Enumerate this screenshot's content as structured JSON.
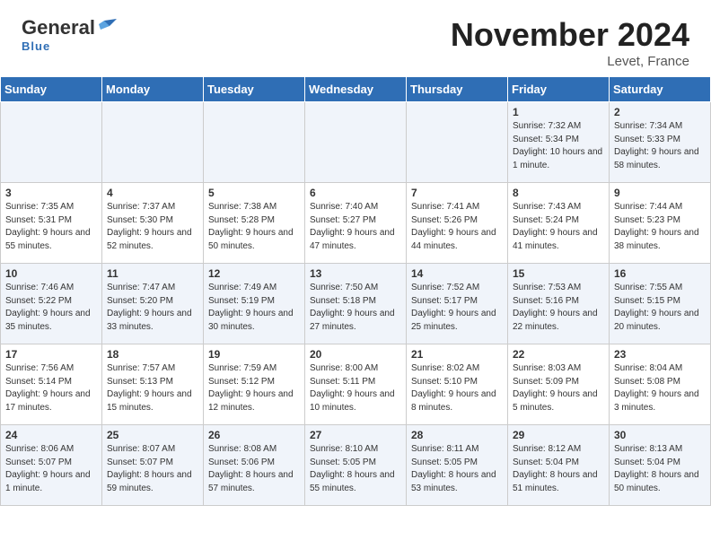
{
  "header": {
    "logo_line1": "General",
    "logo_line2": "Blue",
    "month": "November 2024",
    "location": "Levet, France"
  },
  "weekdays": [
    "Sunday",
    "Monday",
    "Tuesday",
    "Wednesday",
    "Thursday",
    "Friday",
    "Saturday"
  ],
  "weeks": [
    [
      {
        "day": "",
        "info": ""
      },
      {
        "day": "",
        "info": ""
      },
      {
        "day": "",
        "info": ""
      },
      {
        "day": "",
        "info": ""
      },
      {
        "day": "",
        "info": ""
      },
      {
        "day": "1",
        "info": "Sunrise: 7:32 AM\nSunset: 5:34 PM\nDaylight: 10 hours\nand 1 minute."
      },
      {
        "day": "2",
        "info": "Sunrise: 7:34 AM\nSunset: 5:33 PM\nDaylight: 9 hours\nand 58 minutes."
      }
    ],
    [
      {
        "day": "3",
        "info": "Sunrise: 7:35 AM\nSunset: 5:31 PM\nDaylight: 9 hours\nand 55 minutes."
      },
      {
        "day": "4",
        "info": "Sunrise: 7:37 AM\nSunset: 5:30 PM\nDaylight: 9 hours\nand 52 minutes."
      },
      {
        "day": "5",
        "info": "Sunrise: 7:38 AM\nSunset: 5:28 PM\nDaylight: 9 hours\nand 50 minutes."
      },
      {
        "day": "6",
        "info": "Sunrise: 7:40 AM\nSunset: 5:27 PM\nDaylight: 9 hours\nand 47 minutes."
      },
      {
        "day": "7",
        "info": "Sunrise: 7:41 AM\nSunset: 5:26 PM\nDaylight: 9 hours\nand 44 minutes."
      },
      {
        "day": "8",
        "info": "Sunrise: 7:43 AM\nSunset: 5:24 PM\nDaylight: 9 hours\nand 41 minutes."
      },
      {
        "day": "9",
        "info": "Sunrise: 7:44 AM\nSunset: 5:23 PM\nDaylight: 9 hours\nand 38 minutes."
      }
    ],
    [
      {
        "day": "10",
        "info": "Sunrise: 7:46 AM\nSunset: 5:22 PM\nDaylight: 9 hours\nand 35 minutes."
      },
      {
        "day": "11",
        "info": "Sunrise: 7:47 AM\nSunset: 5:20 PM\nDaylight: 9 hours\nand 33 minutes."
      },
      {
        "day": "12",
        "info": "Sunrise: 7:49 AM\nSunset: 5:19 PM\nDaylight: 9 hours\nand 30 minutes."
      },
      {
        "day": "13",
        "info": "Sunrise: 7:50 AM\nSunset: 5:18 PM\nDaylight: 9 hours\nand 27 minutes."
      },
      {
        "day": "14",
        "info": "Sunrise: 7:52 AM\nSunset: 5:17 PM\nDaylight: 9 hours\nand 25 minutes."
      },
      {
        "day": "15",
        "info": "Sunrise: 7:53 AM\nSunset: 5:16 PM\nDaylight: 9 hours\nand 22 minutes."
      },
      {
        "day": "16",
        "info": "Sunrise: 7:55 AM\nSunset: 5:15 PM\nDaylight: 9 hours\nand 20 minutes."
      }
    ],
    [
      {
        "day": "17",
        "info": "Sunrise: 7:56 AM\nSunset: 5:14 PM\nDaylight: 9 hours\nand 17 minutes."
      },
      {
        "day": "18",
        "info": "Sunrise: 7:57 AM\nSunset: 5:13 PM\nDaylight: 9 hours\nand 15 minutes."
      },
      {
        "day": "19",
        "info": "Sunrise: 7:59 AM\nSunset: 5:12 PM\nDaylight: 9 hours\nand 12 minutes."
      },
      {
        "day": "20",
        "info": "Sunrise: 8:00 AM\nSunset: 5:11 PM\nDaylight: 9 hours\nand 10 minutes."
      },
      {
        "day": "21",
        "info": "Sunrise: 8:02 AM\nSunset: 5:10 PM\nDaylight: 9 hours\nand 8 minutes."
      },
      {
        "day": "22",
        "info": "Sunrise: 8:03 AM\nSunset: 5:09 PM\nDaylight: 9 hours\nand 5 minutes."
      },
      {
        "day": "23",
        "info": "Sunrise: 8:04 AM\nSunset: 5:08 PM\nDaylight: 9 hours\nand 3 minutes."
      }
    ],
    [
      {
        "day": "24",
        "info": "Sunrise: 8:06 AM\nSunset: 5:07 PM\nDaylight: 9 hours\nand 1 minute."
      },
      {
        "day": "25",
        "info": "Sunrise: 8:07 AM\nSunset: 5:07 PM\nDaylight: 8 hours\nand 59 minutes."
      },
      {
        "day": "26",
        "info": "Sunrise: 8:08 AM\nSunset: 5:06 PM\nDaylight: 8 hours\nand 57 minutes."
      },
      {
        "day": "27",
        "info": "Sunrise: 8:10 AM\nSunset: 5:05 PM\nDaylight: 8 hours\nand 55 minutes."
      },
      {
        "day": "28",
        "info": "Sunrise: 8:11 AM\nSunset: 5:05 PM\nDaylight: 8 hours\nand 53 minutes."
      },
      {
        "day": "29",
        "info": "Sunrise: 8:12 AM\nSunset: 5:04 PM\nDaylight: 8 hours\nand 51 minutes."
      },
      {
        "day": "30",
        "info": "Sunrise: 8:13 AM\nSunset: 5:04 PM\nDaylight: 8 hours\nand 50 minutes."
      }
    ]
  ]
}
